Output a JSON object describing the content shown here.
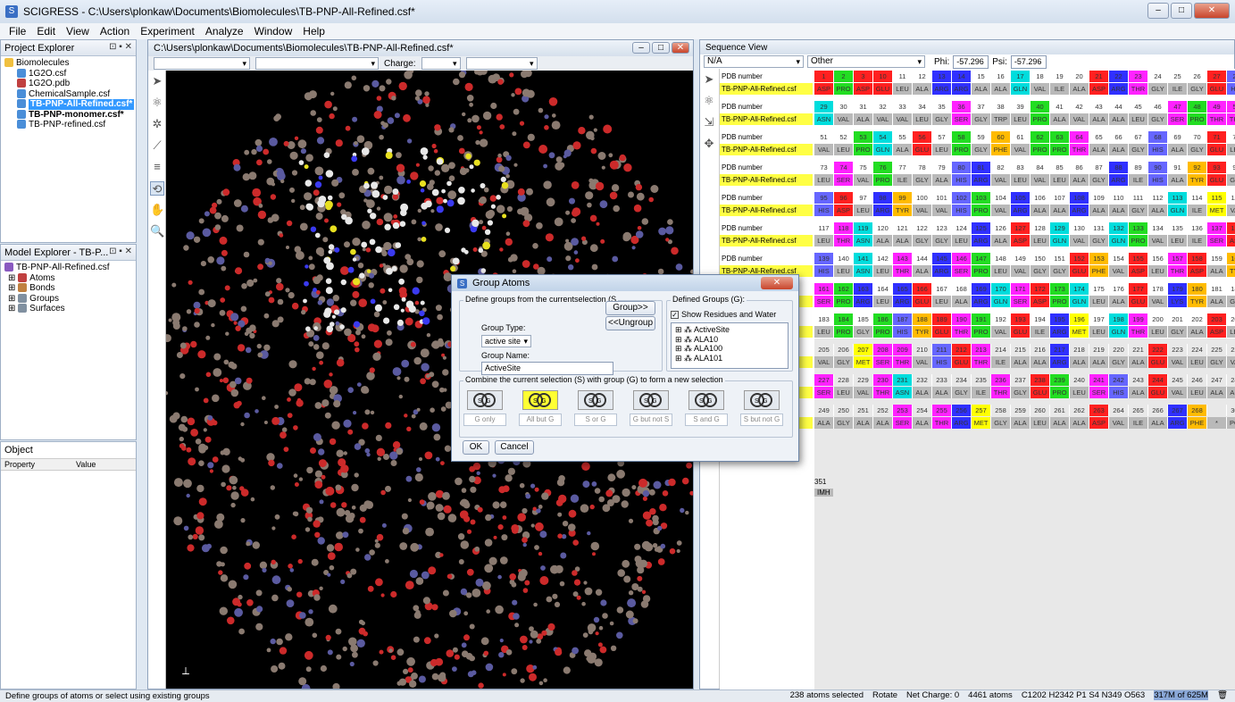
{
  "app": {
    "title": "SCIGRESS - C:\\Users\\plonkaw\\Documents\\Biomolecules\\TB-PNP-All-Refined.csf*"
  },
  "menu": [
    "File",
    "Edit",
    "View",
    "Action",
    "Experiment",
    "Analyze",
    "Window",
    "Help"
  ],
  "project_explorer": {
    "title": "Project Explorer",
    "items": [
      "Biomolecules",
      "1G2O.csf",
      "1G2O.pdb",
      "ChemicalSample.csf",
      "TB-PNP-All-Refined.csf*",
      "TB-PNP-monomer.csf*",
      "TB-PNP-refined.csf"
    ]
  },
  "model_explorer": {
    "title": "Model Explorer - TB-P...",
    "items": [
      "TB-PNP-All-Refined.csf",
      "Atoms",
      "Bonds",
      "Groups",
      "Surfaces"
    ]
  },
  "object_panel": {
    "title": "Object",
    "col_property": "Property",
    "col_value": "Value"
  },
  "document": {
    "title": "C:\\Users\\plonkaw\\Documents\\Biomolecules\\TB-PNP-All-Refined.csf*",
    "charge_label": "Charge:"
  },
  "sequence": {
    "title": "Sequence View",
    "na": "N/A",
    "other": "Other",
    "phi_label": "Phi:",
    "phi": "-57.296",
    "psi_label": "Psi:",
    "psi": "-57.296",
    "pdb_label": "PDB number",
    "name_label": "TB-PNP-All-Refined.csf",
    "rows": [
      {
        "nums": [
          "1",
          "2",
          "3",
          "10",
          "11",
          "12",
          "13",
          "14",
          "15",
          "16",
          "17",
          "18",
          "19",
          "20",
          "21",
          "22",
          "23",
          "24",
          "25",
          "26",
          "27",
          "28"
        ],
        "res": [
          "ASP",
          "PRO",
          "ASP",
          "GLU",
          "LEU",
          "ALA",
          "ARG",
          "ARG",
          "ALA",
          "ALA",
          "GLN",
          "VAL",
          "ILE",
          "ALA",
          "ASP",
          "ARG",
          "THR",
          "GLY",
          "ILE",
          "GLY",
          "GLU",
          "HIS"
        ]
      },
      {
        "nums": [
          "29",
          "30",
          "31",
          "32",
          "33",
          "34",
          "35",
          "36",
          "37",
          "38",
          "39",
          "40",
          "41",
          "42",
          "43",
          "44",
          "45",
          "46",
          "47",
          "48",
          "49",
          "50"
        ],
        "res": [
          "ASN",
          "VAL",
          "ALA",
          "VAL",
          "VAL",
          "LEU",
          "GLY",
          "SER",
          "GLY",
          "TRP",
          "LEU",
          "PRO",
          "ALA",
          "VAL",
          "ALA",
          "ALA",
          "LEU",
          "GLY",
          "SER",
          "PRO",
          "THR",
          "THR"
        ]
      },
      {
        "nums": [
          "51",
          "52",
          "53",
          "54",
          "55",
          "56",
          "57",
          "58",
          "59",
          "60",
          "61",
          "62",
          "63",
          "64",
          "65",
          "66",
          "67",
          "68",
          "69",
          "70",
          "71",
          "72"
        ],
        "res": [
          "VAL",
          "LEU",
          "PRO",
          "GLN",
          "ALA",
          "GLU",
          "LEU",
          "PRO",
          "GLY",
          "PHE",
          "VAL",
          "PRO",
          "PRO",
          "THR",
          "ALA",
          "ALA",
          "GLY",
          "HIS",
          "ALA",
          "GLY",
          "GLU",
          "LEU"
        ]
      },
      {
        "nums": [
          "73",
          "74",
          "75",
          "76",
          "77",
          "78",
          "79",
          "80",
          "81",
          "82",
          "83",
          "84",
          "85",
          "86",
          "87",
          "88",
          "89",
          "90",
          "91",
          "92",
          "93",
          "94"
        ],
        "res": [
          "LEU",
          "SER",
          "VAL",
          "PRO",
          "ILE",
          "GLY",
          "ALA",
          "HIS",
          "ARG",
          "VAL",
          "LEU",
          "VAL",
          "LEU",
          "ALA",
          "GLY",
          "ARG",
          "ILE",
          "HIS",
          "ALA",
          "TYR",
          "GLU",
          "GLY"
        ]
      },
      {
        "nums": [
          "95",
          "96",
          "97",
          "98",
          "99",
          "100",
          "101",
          "102",
          "103",
          "104",
          "105",
          "106",
          "107",
          "108",
          "109",
          "110",
          "111",
          "112",
          "113",
          "114",
          "115",
          "116"
        ],
        "res": [
          "HIS",
          "ASP",
          "LEU",
          "ARG",
          "TYR",
          "VAL",
          "VAL",
          "HIS",
          "PRO",
          "VAL",
          "ARG",
          "ALA",
          "ALA",
          "ARG",
          "ALA",
          "ALA",
          "GLY",
          "ALA",
          "GLN",
          "ILE",
          "MET",
          "VAL"
        ]
      },
      {
        "nums": [
          "117",
          "118",
          "119",
          "120",
          "121",
          "122",
          "123",
          "124",
          "125",
          "126",
          "127",
          "128",
          "129",
          "130",
          "131",
          "132",
          "133",
          "134",
          "135",
          "136",
          "137",
          "138"
        ],
        "res": [
          "LEU",
          "THR",
          "ASN",
          "ALA",
          "ALA",
          "GLY",
          "GLY",
          "LEU",
          "ARG",
          "ALA",
          "ASP",
          "LEU",
          "GLN",
          "VAL",
          "GLY",
          "GLN",
          "PRO",
          "VAL",
          "LEU",
          "ILE",
          "SER",
          "ASP"
        ]
      },
      {
        "nums": [
          "139",
          "140",
          "141",
          "142",
          "143",
          "144",
          "145",
          "146",
          "147",
          "148",
          "149",
          "150",
          "151",
          "152",
          "153",
          "154",
          "155",
          "156",
          "157",
          "158",
          "159",
          "160"
        ],
        "res": [
          "HIS",
          "LEU",
          "ASN",
          "LEU",
          "THR",
          "ALA",
          "ARG",
          "SER",
          "PRO",
          "LEU",
          "VAL",
          "GLY",
          "GLY",
          "GLU",
          "PHE",
          "VAL",
          "ASP",
          "LEU",
          "THR",
          "ASP",
          "ALA",
          "TYR"
        ]
      },
      {
        "nums": [
          "161",
          "162",
          "163",
          "164",
          "165",
          "166",
          "167",
          "168",
          "169",
          "170",
          "171",
          "172",
          "173",
          "174",
          "175",
          "176",
          "177",
          "178",
          "179",
          "180",
          "181",
          "182"
        ],
        "res": [
          "SER",
          "PRO",
          "ARG",
          "LEU",
          "ARG",
          "GLU",
          "LEU",
          "ALA",
          "ARG",
          "GLN",
          "SER",
          "ASP",
          "PRO",
          "GLN",
          "LEU",
          "ALA",
          "GLU",
          "VAL",
          "LYS",
          "TYR",
          "ALA",
          "GLY"
        ]
      },
      {
        "nums": [
          "183",
          "184",
          "185",
          "186",
          "187",
          "188",
          "189",
          "190",
          "191",
          "192",
          "193",
          "194",
          "195",
          "196",
          "197",
          "198",
          "199",
          "200",
          "201",
          "202",
          "203",
          "204"
        ],
        "res": [
          "LEU",
          "PRO",
          "GLY",
          "PRO",
          "HIS",
          "TYR",
          "GLU",
          "THR",
          "PRO",
          "VAL",
          "GLU",
          "ILE",
          "ARG",
          "MET",
          "LEU",
          "GLN",
          "THR",
          "LEU",
          "GLY",
          "ALA",
          "ASP",
          "LEU"
        ]
      },
      {
        "nums": [
          "205",
          "206",
          "207",
          "208",
          "209",
          "210",
          "211",
          "212",
          "213",
          "214",
          "215",
          "216",
          "217",
          "218",
          "219",
          "220",
          "221",
          "222",
          "223",
          "224",
          "225",
          "226"
        ],
        "res": [
          "VAL",
          "GLY",
          "MET",
          "SER",
          "THR",
          "VAL",
          "HIS",
          "GLU",
          "THR",
          "ILE",
          "ALA",
          "ALA",
          "ARG",
          "ALA",
          "ALA",
          "GLY",
          "ALA",
          "GLU",
          "VAL",
          "LEU",
          "GLY",
          "VAL"
        ]
      },
      {
        "nums": [
          "227",
          "228",
          "229",
          "230",
          "231",
          "232",
          "233",
          "234",
          "235",
          "236",
          "237",
          "238",
          "239",
          "240",
          "241",
          "242",
          "243",
          "244",
          "245",
          "246",
          "247",
          "248"
        ],
        "res": [
          "SER",
          "LEU",
          "VAL",
          "THR",
          "ASN",
          "ALA",
          "ALA",
          "GLY",
          "ILE",
          "THR",
          "GLY",
          "GLU",
          "PRO",
          "LEU",
          "SER",
          "HIS",
          "ALA",
          "GLU",
          "VAL",
          "LEU",
          "ALA",
          "ALA"
        ]
      },
      {
        "nums": [
          "249",
          "250",
          "251",
          "252",
          "253",
          "254",
          "255",
          "256",
          "257",
          "258",
          "259",
          "260",
          "261",
          "262",
          "263",
          "264",
          "265",
          "266",
          "267",
          "268",
          "",
          "301"
        ],
        "res": [
          "ALA",
          "GLY",
          "ALA",
          "ALA",
          "SER",
          "ALA",
          "THR",
          "ARG",
          "MET",
          "GLY",
          "ALA",
          "LEU",
          "ALA",
          "ALA",
          "ASP",
          "VAL",
          "ILE",
          "ALA",
          "ARG",
          "PHE",
          "*",
          "PO4"
        ]
      }
    ],
    "tail_num": "351",
    "tail_res": "IMH"
  },
  "dialog": {
    "title": "Group Atoms",
    "define_legend": "Define groups from the currentselection (S",
    "group_type_label": "Group Type:",
    "group_type": "active site",
    "group_name_label": "Group Name:",
    "group_name": "ActiveSite",
    "group_btn": "Group>>",
    "ungroup_btn": "<<Ungroup",
    "defined_legend": "Defined Groups (G):",
    "show_residues": "Show Residues and Water",
    "groups": [
      "ActiveSite",
      "ALA10",
      "ALA100",
      "ALA101",
      "ALA103",
      "ALA104"
    ],
    "combine_legend": "Combine the current selection (S) with group (G) to form a new selection",
    "ops": [
      "G only",
      "All but G",
      "S or G",
      "G but not S",
      "S and G",
      "S but not G"
    ],
    "ok": "OK",
    "cancel": "Cancel"
  },
  "status": {
    "left": "Define groups of atoms or select using existing groups",
    "selected": "238 atoms selected",
    "mode": "Rotate",
    "charge": "Net Charge: 0",
    "atoms": "4461 atoms",
    "formula": "C1202 H2342 P1 S4 N349 O563",
    "memory": "317M of 625M"
  },
  "colors": {
    "ASP": "#ff2020",
    "GLU": "#ff2020",
    "ARG": "#3030ff",
    "LYS": "#3030ff",
    "HIS": "#6666ff",
    "PRO": "#22dd22",
    "THR": "#ff22ff",
    "SER": "#ff22ff",
    "GLN": "#00dddd",
    "ASN": "#00dddd",
    "TYR": "#ffbb00",
    "MET": "#ffff00",
    "PHE": "#ffbb00",
    "default": "#b9b9b9"
  }
}
